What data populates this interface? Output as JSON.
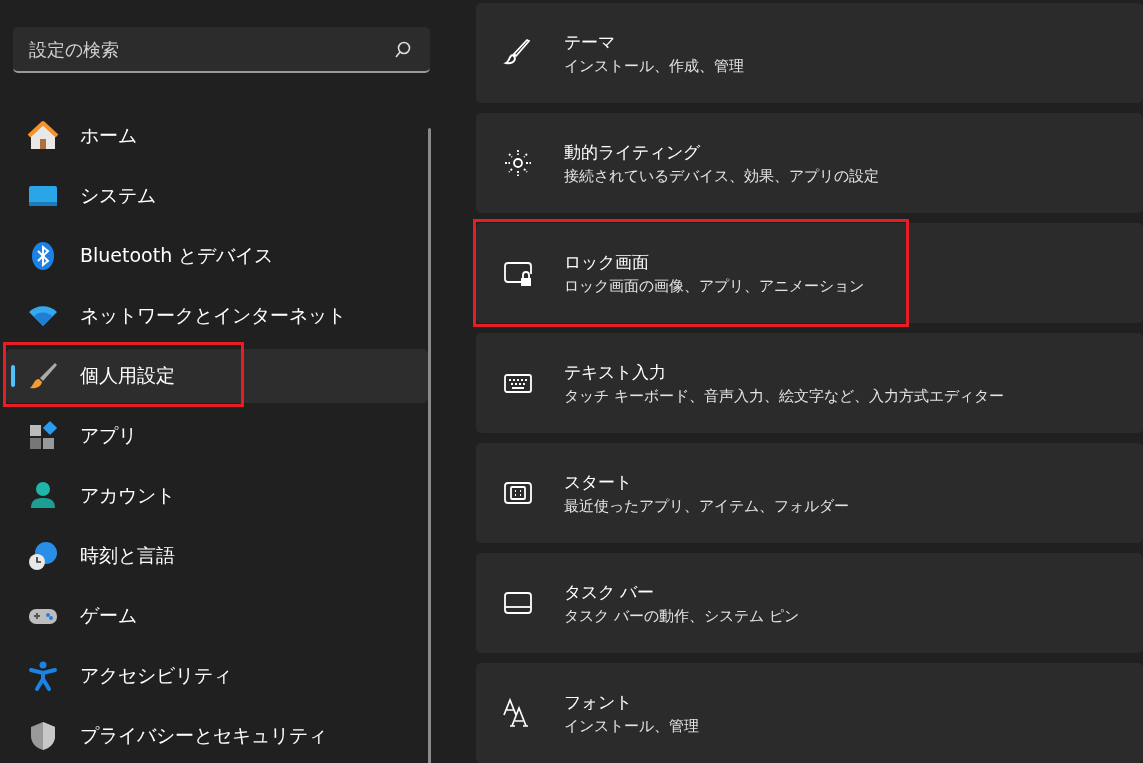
{
  "search": {
    "placeholder": "設定の検索"
  },
  "sidebar": {
    "items": [
      {
        "label": "ホーム",
        "selected": false,
        "highlighted": false
      },
      {
        "label": "システム",
        "selected": false,
        "highlighted": false
      },
      {
        "label": "Bluetooth とデバイス",
        "selected": false,
        "highlighted": false
      },
      {
        "label": "ネットワークとインターネット",
        "selected": false,
        "highlighted": false
      },
      {
        "label": "個人用設定",
        "selected": true,
        "highlighted": true
      },
      {
        "label": "アプリ",
        "selected": false,
        "highlighted": false
      },
      {
        "label": "アカウント",
        "selected": false,
        "highlighted": false
      },
      {
        "label": "時刻と言語",
        "selected": false,
        "highlighted": false
      },
      {
        "label": "ゲーム",
        "selected": false,
        "highlighted": false
      },
      {
        "label": "アクセシビリティ",
        "selected": false,
        "highlighted": false
      },
      {
        "label": "プライバシーとセキュリティ",
        "selected": false,
        "highlighted": false
      }
    ]
  },
  "settings": [
    {
      "title": "テーマ",
      "description": "インストール、作成、管理",
      "highlighted": false
    },
    {
      "title": "動的ライティング",
      "description": "接続されているデバイス、効果、アプリの設定",
      "highlighted": false
    },
    {
      "title": "ロック画面",
      "description": "ロック画面の画像、アプリ、アニメーション",
      "highlighted": true
    },
    {
      "title": "テキスト入力",
      "description": "タッチ キーボード、音声入力、絵文字など、入力方式エディター",
      "highlighted": false
    },
    {
      "title": "スタート",
      "description": "最近使ったアプリ、アイテム、フォルダー",
      "highlighted": false
    },
    {
      "title": "タスク バー",
      "description": "タスク バーの動作、システム ピン",
      "highlighted": false
    },
    {
      "title": "フォント",
      "description": "インストール、管理",
      "highlighted": false
    }
  ]
}
